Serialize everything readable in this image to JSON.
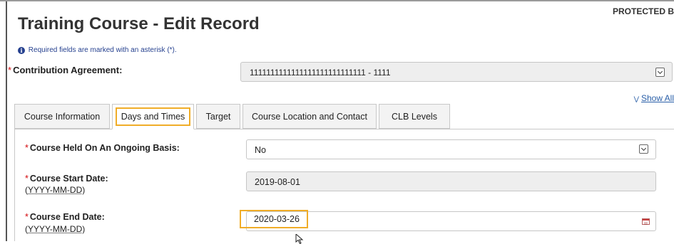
{
  "header": {
    "protected_label": "PROTECTED B",
    "title": "Training Course - Edit Record",
    "required_note": "Required fields are marked with an asterisk (*)."
  },
  "contribution_agreement": {
    "label": "Contribution Agreement:",
    "value": "1111111111111111111111111111 - 1111"
  },
  "show_all_label": "Show All",
  "tabs": [
    {
      "label": "Course Information"
    },
    {
      "label": "Days and Times",
      "active": true
    },
    {
      "label": "Target"
    },
    {
      "label": "Course Location and Contact"
    },
    {
      "label": "CLB Levels"
    }
  ],
  "fields": {
    "ongoing": {
      "label": "Course Held On An Ongoing Basis:",
      "value": "No"
    },
    "start_date": {
      "label": "Course Start Date:",
      "format": "(YYYY-MM-DD)",
      "value": "2019-08-01"
    },
    "end_date": {
      "label": "Course End Date:",
      "format": "(YYYY-MM-DD)",
      "value": "2020-03-26"
    }
  },
  "colors": {
    "asterisk": "#d3080c",
    "link": "#2a5fa8",
    "highlight": "#f0ad28",
    "info_icon": "#26418f"
  },
  "icons": [
    "info-icon",
    "chevron-down-icon",
    "double-chevron-down-icon",
    "calendar-icon",
    "mouse-cursor-icon"
  ]
}
